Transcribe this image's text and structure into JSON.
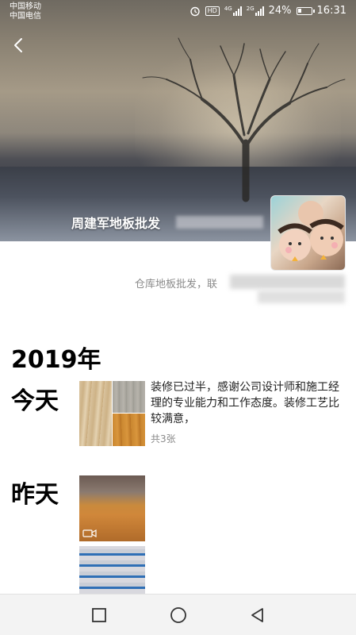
{
  "status_bar": {
    "carrier_1": "中国移动",
    "carrier_2": "中国电信",
    "network_1": "4G",
    "network_2": "2G",
    "battery": "24%",
    "battery_level": 0.24,
    "time": "16:31",
    "hd_label": "HD"
  },
  "profile": {
    "name": "周建军地板批发",
    "signature": "仓库地板批发，联"
  },
  "timeline": {
    "year": "2019年",
    "entries": [
      {
        "day": "今天",
        "text": "装修已过半，感谢公司设计师和施工经理的专业能力和工作态度。装修工艺比较满意，",
        "count": "共3张"
      },
      {
        "day": "昨天"
      }
    ]
  },
  "colors": {
    "primary_text": "#000000",
    "secondary_text": "#8a8a8a",
    "navbar_bg": "#f3f3f3"
  },
  "icons": {
    "back": "back-arrow-icon",
    "alarm": "alarm-icon",
    "video": "video-icon",
    "nav_recent": "square-icon",
    "nav_home": "circle-icon",
    "nav_back": "triangle-back-icon"
  }
}
